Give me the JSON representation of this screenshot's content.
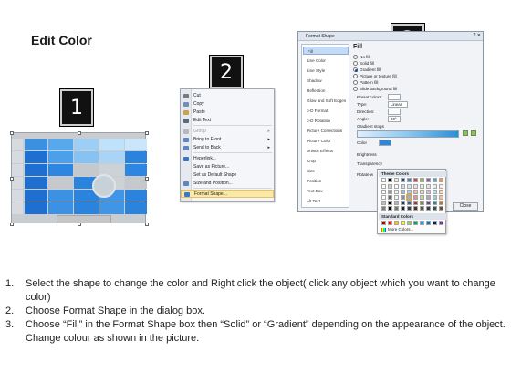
{
  "title": "Edit Color",
  "badges": [
    "1",
    "2",
    "3"
  ],
  "context_menu": {
    "items": [
      {
        "label": "Cut",
        "underline": "t",
        "icon": "scissors-icon",
        "icon_color": "#7a7a7a",
        "state": "normal"
      },
      {
        "label": "Copy",
        "icon": "copy-icon",
        "icon_color": "#6f8fb7",
        "state": "normal"
      },
      {
        "label": "Paste",
        "icon": "paste-icon",
        "icon_color": "#c9a24b",
        "state": "normal"
      },
      {
        "label": "Edit Text",
        "icon": "edit-text-icon",
        "icon_color": "#5b6a7b",
        "state": "normal"
      },
      {
        "label": "Group",
        "icon": "group-icon",
        "icon_color": "#b8b8b8",
        "state": "disabled",
        "submenu": true
      },
      {
        "label": "Bring to Front",
        "icon": "bring-to-front-icon",
        "icon_color": "#5d86c0",
        "state": "normal",
        "submenu": true
      },
      {
        "label": "Send to Back",
        "icon": "send-to-back-icon",
        "icon_color": "#5d86c0",
        "state": "normal",
        "submenu": true
      },
      {
        "label": "Hyperlink...",
        "icon": "hyperlink-icon",
        "icon_color": "#3d74c1",
        "state": "normal"
      },
      {
        "label": "Save as Picture...",
        "icon": "",
        "state": "normal"
      },
      {
        "label": "Set as Default Shape",
        "icon": "",
        "state": "normal"
      },
      {
        "label": "Size and Position...",
        "icon": "size-position-icon",
        "icon_color": "#5d86c0",
        "state": "normal"
      },
      {
        "label": "Format Shape...",
        "icon": "format-shape-icon",
        "icon_color": "#3c78c3",
        "state": "highlighted"
      }
    ]
  },
  "dialog": {
    "title": "Format Shape",
    "controls": "? ✕",
    "categories": [
      "Fill",
      "Line Color",
      "Line Style",
      "Shadow",
      "Reflection",
      "Glow and Soft Edges",
      "3-D Format",
      "3-D Rotation",
      "Picture Corrections",
      "Picture Color",
      "Artistic Effects",
      "Crop",
      "Size",
      "Position",
      "Text Box",
      "Alt Text"
    ],
    "selected_category": "Fill",
    "heading": "Fill",
    "options": [
      {
        "label": "No fill",
        "on": false
      },
      {
        "label": "Solid fill",
        "on": false
      },
      {
        "label": "Gradient fill",
        "on": true
      },
      {
        "label": "Picture or texture fill",
        "on": false
      },
      {
        "label": "Pattern fill",
        "on": false
      },
      {
        "label": "Slide background fill",
        "on": false
      }
    ],
    "preset_label": "Preset colors:",
    "type_label": "Type:",
    "type_value": "Linear",
    "direction_label": "Direction:",
    "angle_label": "Angle:",
    "angle_value": "90°",
    "stops_label": "Gradient stops",
    "color_label": "Color",
    "brightness_label": "Brightness",
    "transparency_label": "Transparency",
    "rotate_label": "Rotate w",
    "close_label": "Close"
  },
  "palette": {
    "theme_header": "Theme Colors",
    "standard_header": "Standard Colors",
    "more_label": "More Colors...",
    "theme_top": [
      "#ffffff",
      "#000000",
      "#eeece1",
      "#1f497d",
      "#4f81bd",
      "#c0504d",
      "#9bbb59",
      "#8064a2",
      "#4bacc6",
      "#f79646"
    ],
    "standard": [
      "#c00000",
      "#ff0000",
      "#ffc000",
      "#ffff00",
      "#92d050",
      "#00b050",
      "#00b0f0",
      "#0070c0",
      "#002060",
      "#7030a0"
    ]
  },
  "instructions": [
    {
      "num": "1.",
      "text": "Select the shape to change the color and Right click the object( click any object which you want to change color)"
    },
    {
      "num": "2.",
      "text": "Choose Format Shape in the dialog box."
    },
    {
      "num": "3.",
      "text": "Choose “Fill” in the Format Shape box then “Solid” or “Gradient” depending on the appearance of the object. Change colour as shown in the picture."
    }
  ]
}
